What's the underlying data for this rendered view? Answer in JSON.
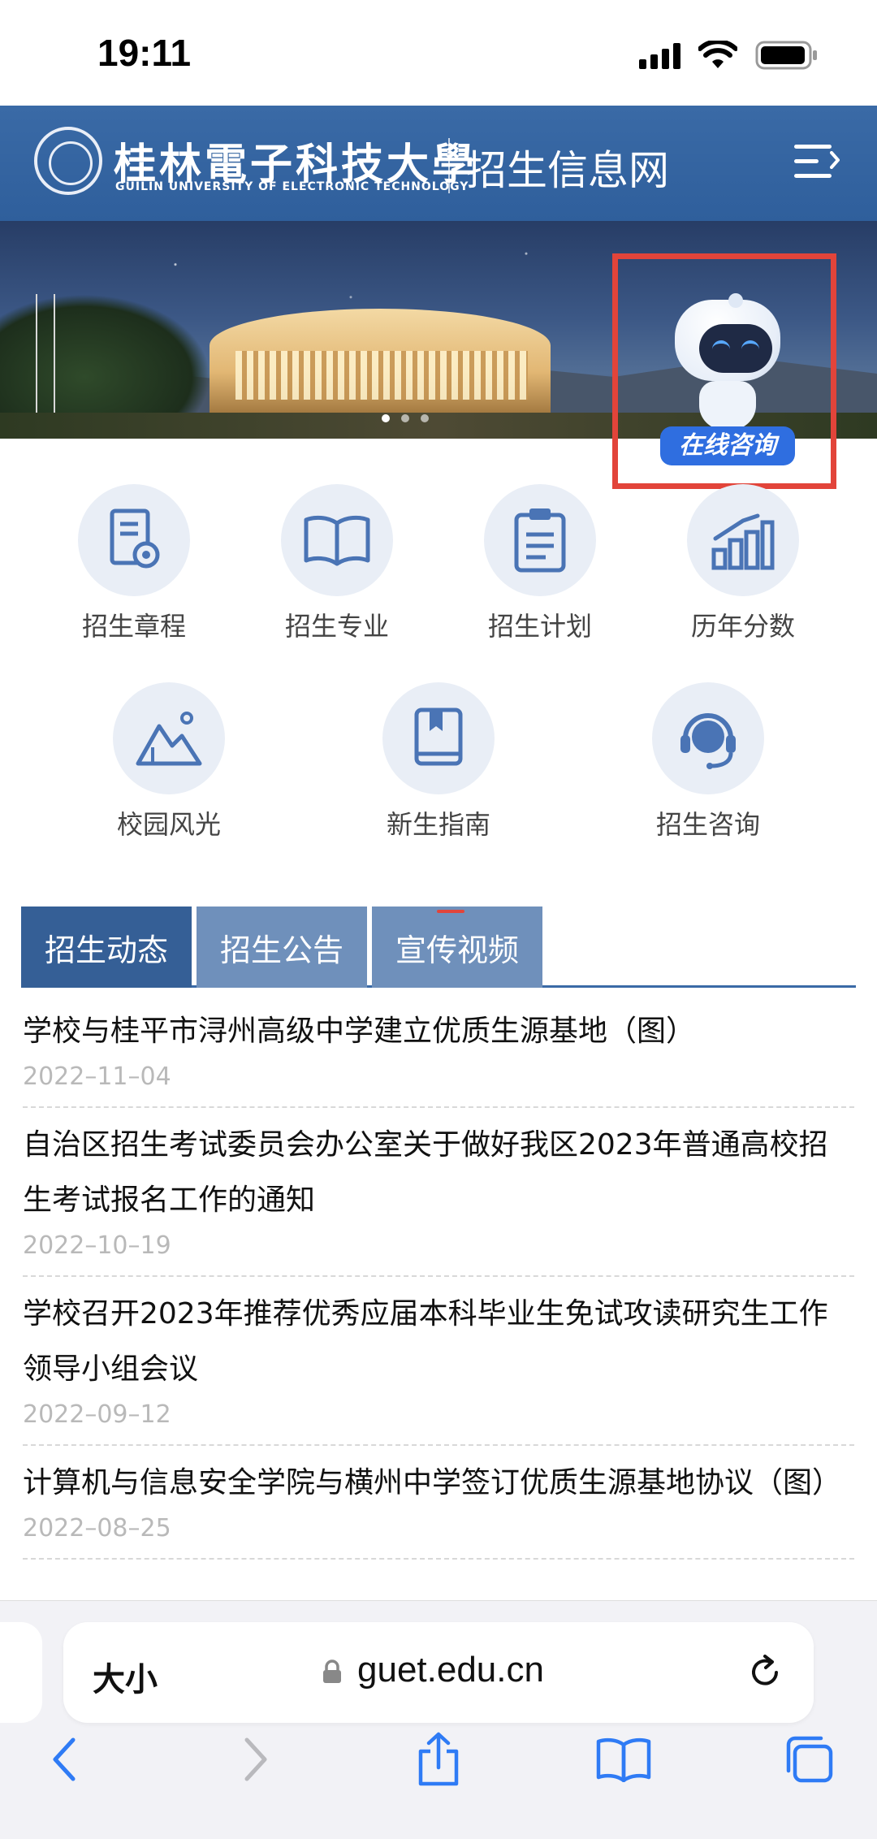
{
  "status_bar": {
    "time": "19:11"
  },
  "header": {
    "university_name": "桂林電子科技大學",
    "university_english": "GUILIN UNIVERSITY OF ELECTRONIC TECHNOLOGY",
    "site_title": "招生信息网"
  },
  "chatbot": {
    "label": "在线咨询"
  },
  "quick_nav": {
    "items": [
      {
        "label": "招生章程",
        "icon": "document-seal-icon"
      },
      {
        "label": "招生专业",
        "icon": "open-book-icon"
      },
      {
        "label": "招生计划",
        "icon": "clipboard-icon"
      },
      {
        "label": "历年分数",
        "icon": "bar-chart-icon"
      },
      {
        "label": "校园风光",
        "icon": "mountain-icon"
      },
      {
        "label": "新生指南",
        "icon": "book-icon"
      },
      {
        "label": "招生咨询",
        "icon": "headset-icon"
      }
    ]
  },
  "tabs": [
    {
      "label": "招生动态",
      "active": true
    },
    {
      "label": "招生公告",
      "active": false
    },
    {
      "label": "宣传视频",
      "active": false
    }
  ],
  "news": [
    {
      "title": "学校与桂平市浔州高级中学建立优质生源基地（图）",
      "date": "2022–11–04"
    },
    {
      "title": "自治区招生考试委员会办公室关于做好我区2023年普通高校招生考试报名工作的通知",
      "date": "2022–10–19"
    },
    {
      "title": "学校召开2023年推荐优秀应届本科毕业生免试攻读研究生工作领导小组会议",
      "date": "2022–09–12"
    },
    {
      "title": "计算机与信息安全学院与横州中学签订优质生源基地协议（图）",
      "date": "2022–08–25"
    }
  ],
  "browser": {
    "text_size_label": "大小",
    "url": "guet.edu.cn"
  },
  "colors": {
    "header_blue": "#3a6aa6",
    "tab_active": "#355f96",
    "tab_inactive": "#6f90bb",
    "highlight_red": "#e2443a",
    "icon_blue": "#4a74b5"
  }
}
